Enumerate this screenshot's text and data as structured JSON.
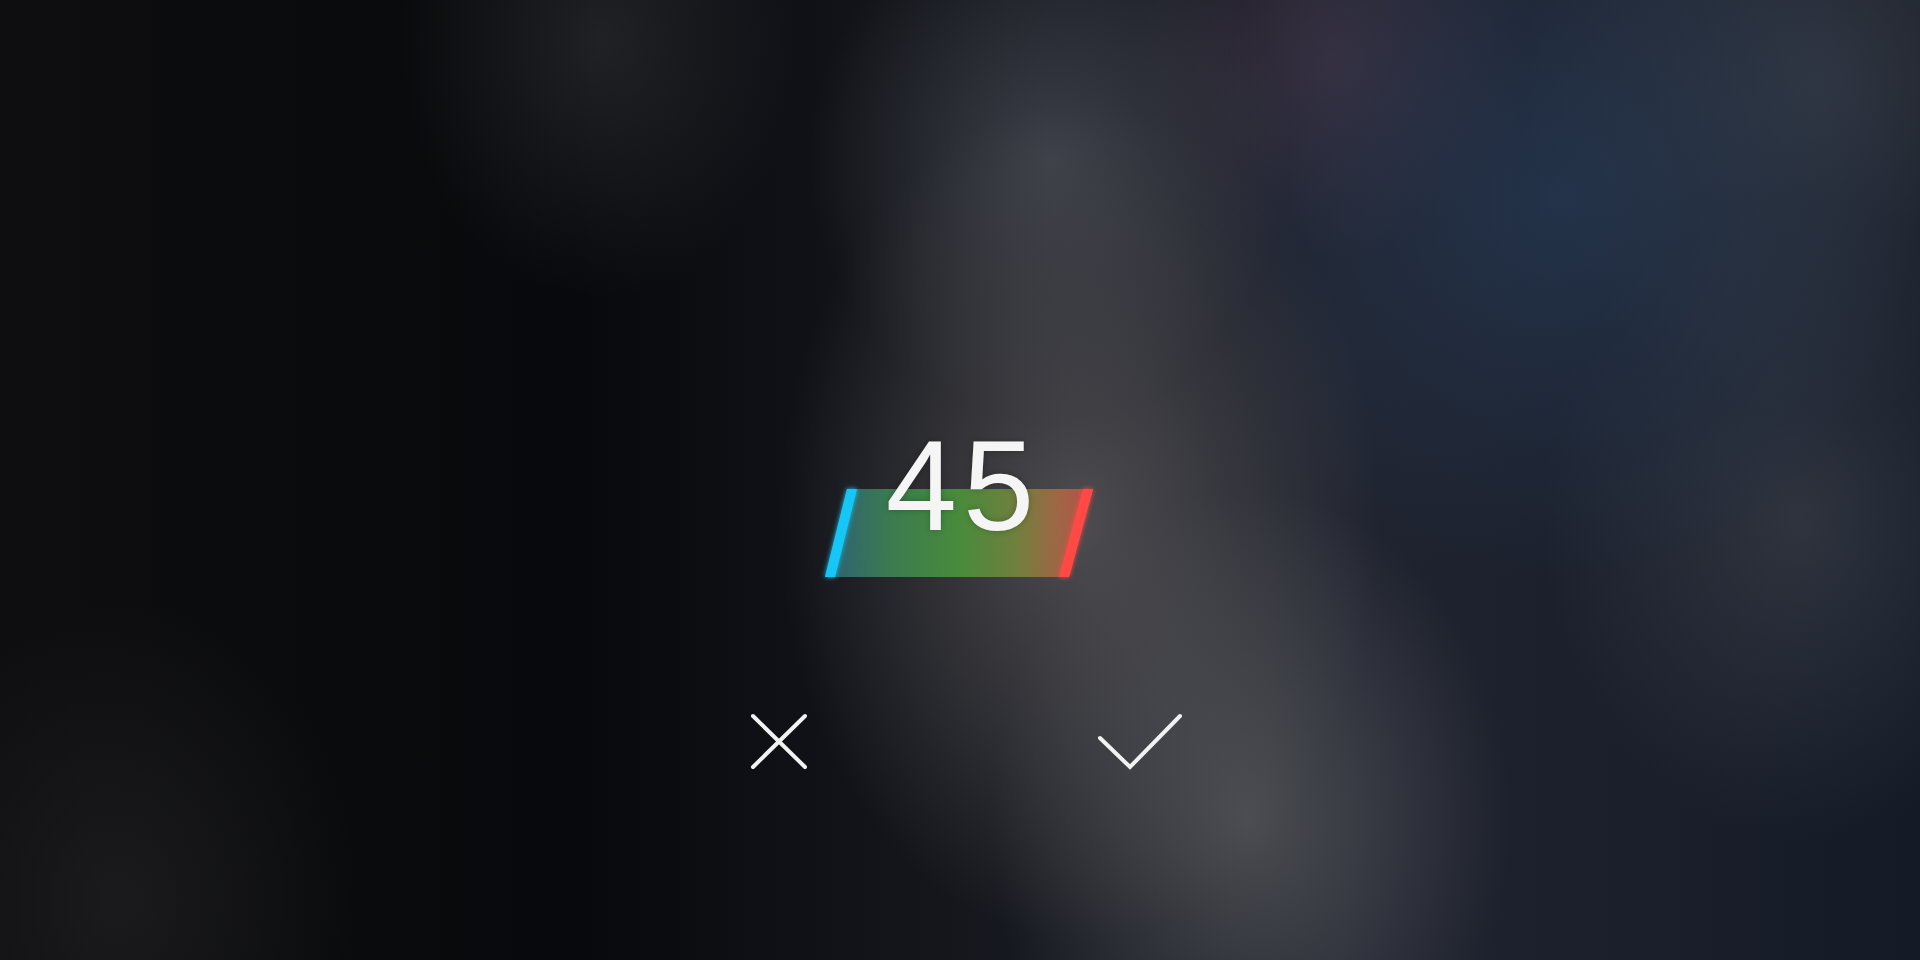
{
  "reading": {
    "value": "45"
  }
}
